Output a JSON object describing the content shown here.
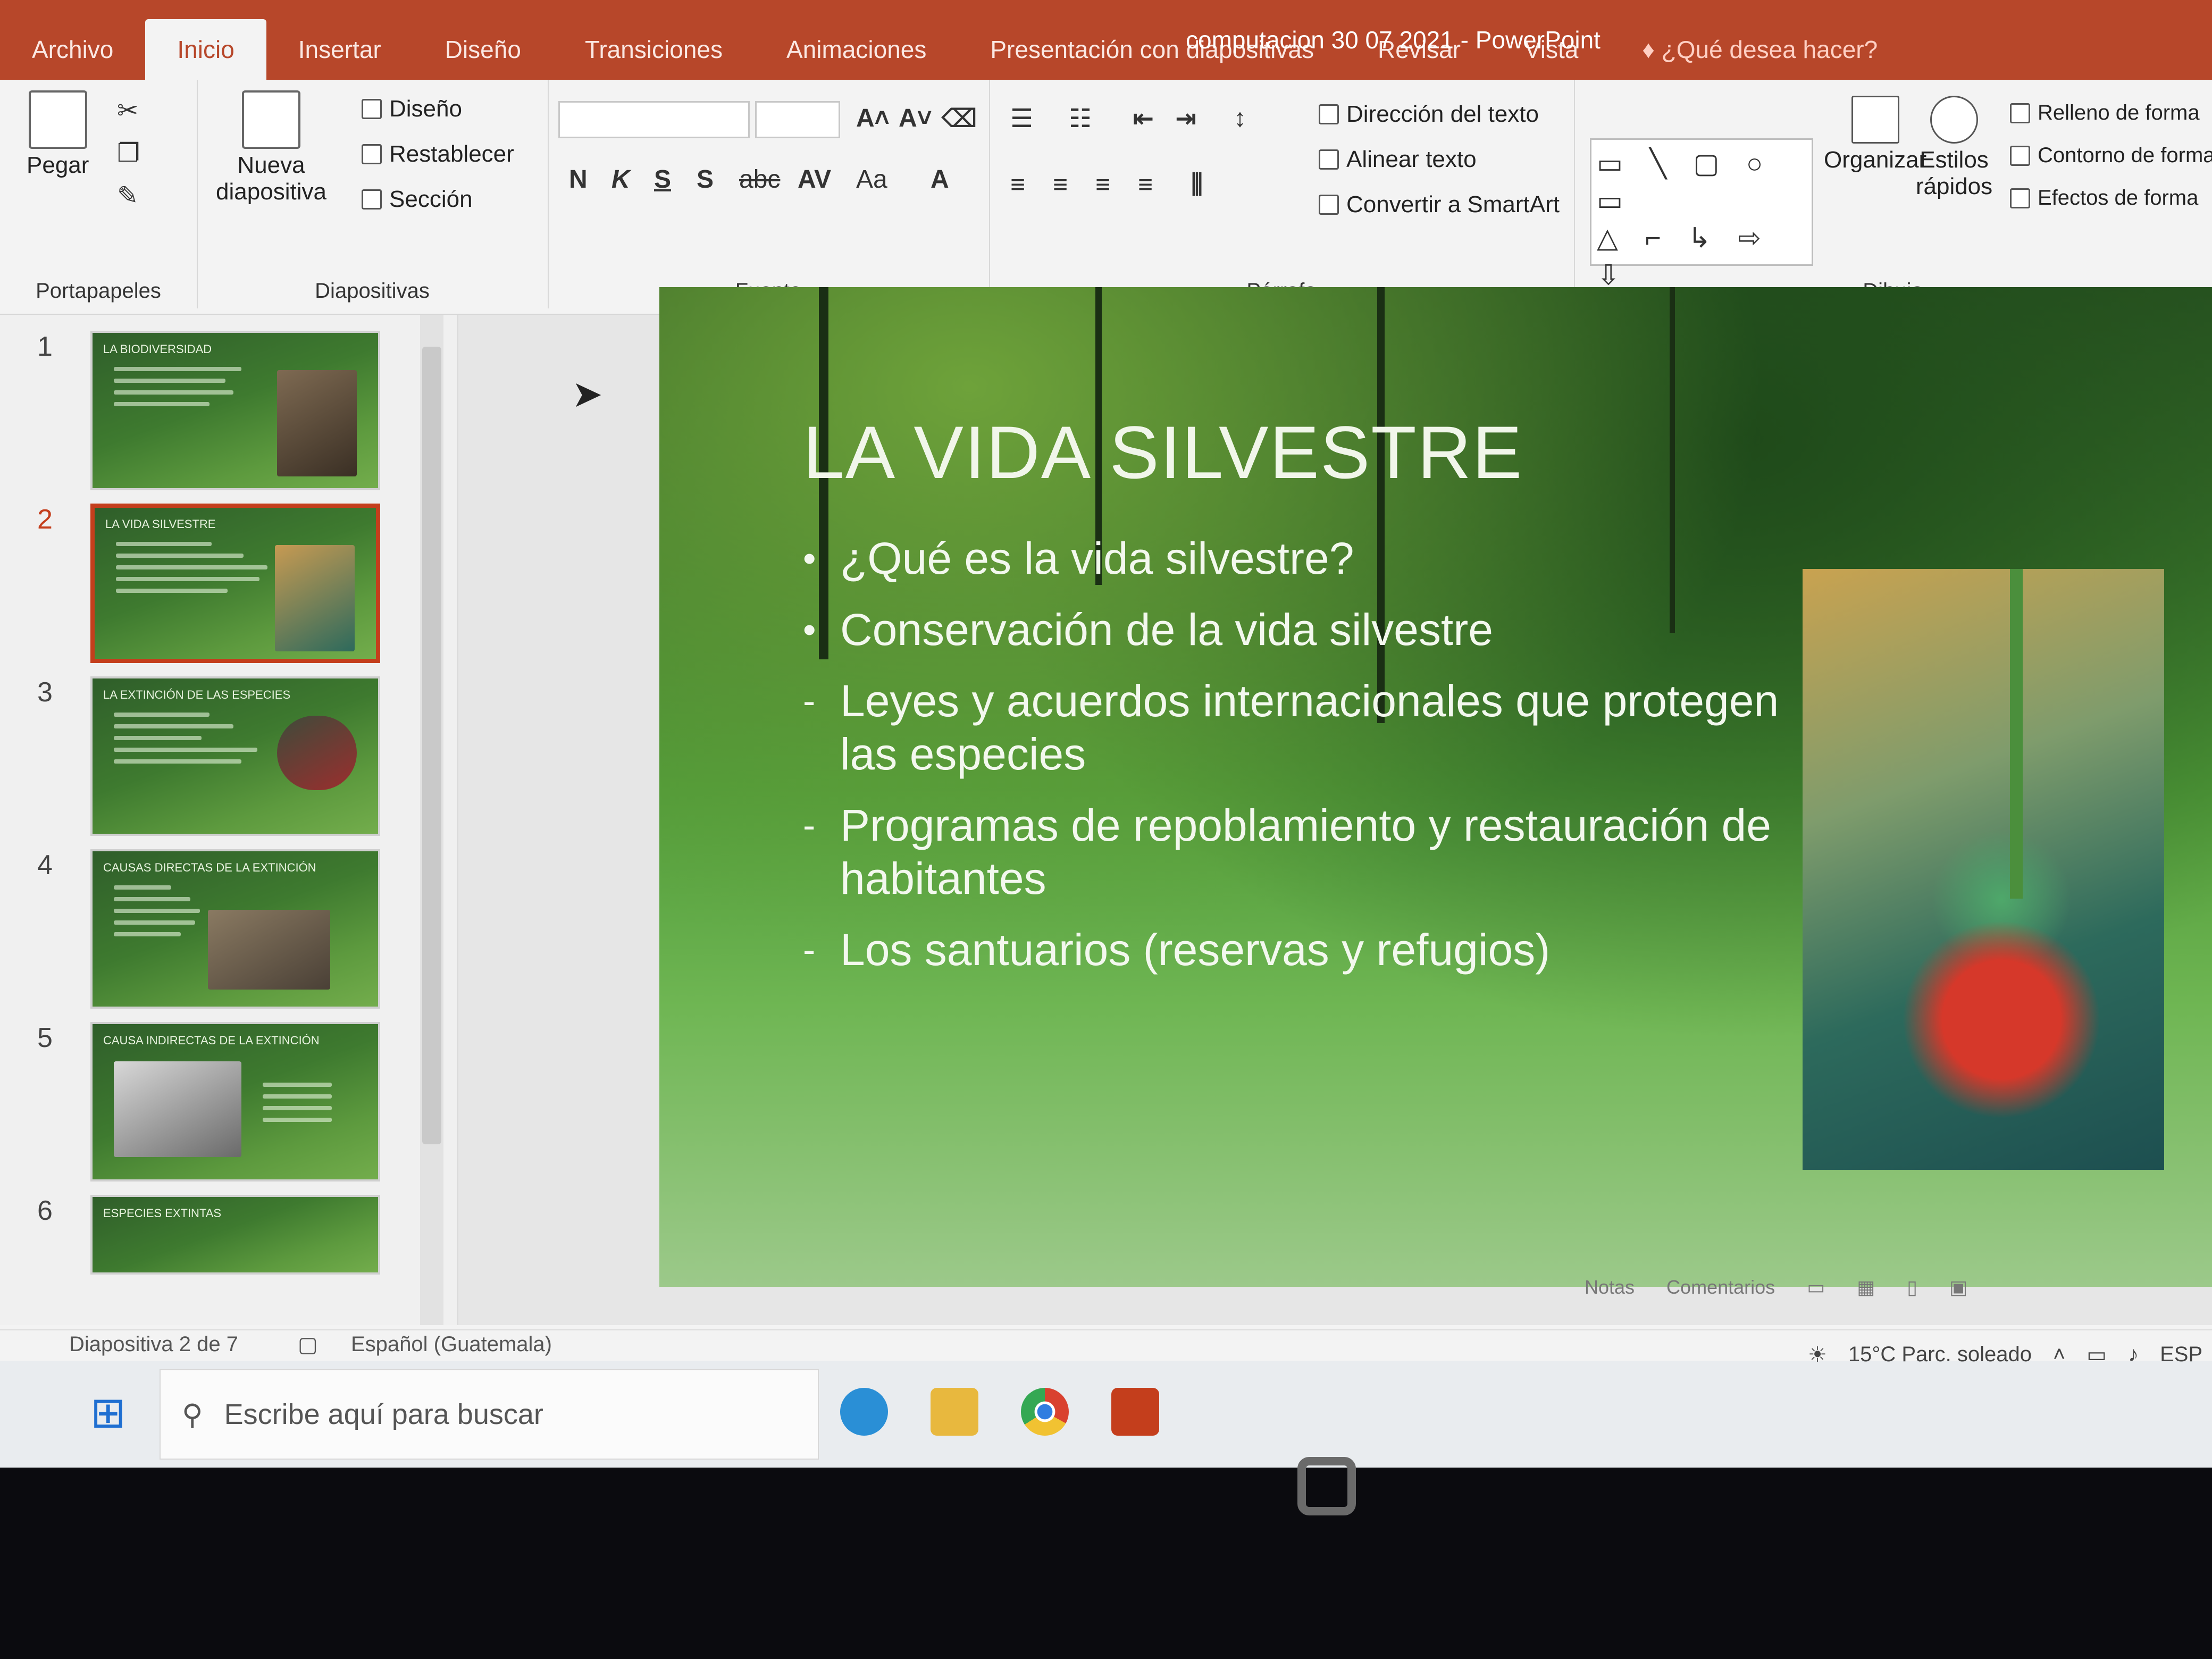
{
  "window": {
    "title": "computacion 30 07 2021 - PowerPoint"
  },
  "tabs": [
    "Archivo",
    "Inicio",
    "Insertar",
    "Diseño",
    "Transiciones",
    "Animaciones",
    "Presentación con diapositivas",
    "Revisar",
    "Vista"
  ],
  "tell_me": "¿Qué desea hacer?",
  "ribbon": {
    "portapapeles": {
      "label": "Portapapeles",
      "paste": "Pegar"
    },
    "diapositivas": {
      "label": "Diapositivas",
      "new_slide": "Nueva diapositiva",
      "layout": "Diseño",
      "reset": "Restablecer",
      "section": "Sección"
    },
    "fuente": {
      "label": "Fuente",
      "bold": "N",
      "italic": "K",
      "underline": "S",
      "shadow": "S",
      "strike": "abc",
      "spacing": "AV",
      "case": "Aa",
      "color": "A"
    },
    "parrafo": {
      "label": "Párrafo",
      "text_direction": "Dirección del texto",
      "align_text": "Alinear texto",
      "smartart": "Convertir a SmartArt"
    },
    "dibujo": {
      "label": "Dibujo",
      "arrange": "Organizar",
      "quick_styles": "Estilos rápidos",
      "fill": "Relleno de forma",
      "outline": "Contorno de forma",
      "effects": "Efectos de forma"
    }
  },
  "thumbnails": [
    {
      "num": "1",
      "title": "LA BIODIVERSIDAD"
    },
    {
      "num": "2",
      "title": "LA VIDA SILVESTRE"
    },
    {
      "num": "3",
      "title": "LA EXTINCIÓN DE LAS ESPECIES"
    },
    {
      "num": "4",
      "title": "CAUSAS DIRECTAS DE LA EXTINCIÓN"
    },
    {
      "num": "5",
      "title": "CAUSA INDIRECTAS DE LA EXTINCIÓN"
    },
    {
      "num": "6",
      "title": "ESPECIES EXTINTAS"
    }
  ],
  "slide": {
    "title": "LA VIDA SILVESTRE",
    "bullets": [
      {
        "text": "¿Qué es la vida silvestre?",
        "level": "bullet"
      },
      {
        "text": "Conservación de la vida silvestre",
        "level": "bullet"
      },
      {
        "text": "Leyes y acuerdos internacionales que protegen las especies",
        "level": "sub"
      },
      {
        "text": "Programas de repoblamiento y restauración de habitantes",
        "level": "sub"
      },
      {
        "text": "Los santuarios (reservas y refugios)",
        "level": "sub"
      }
    ]
  },
  "notes_bar": {
    "notes": "Notas",
    "comments": "Comentarios"
  },
  "status": {
    "slide_counter": "Diapositiva 2 de 7",
    "language": "Español (Guatemala)"
  },
  "taskbar": {
    "search_placeholder": "Escribe aquí para buscar",
    "weather": "15°C Parc. soleado",
    "lang": "ESP"
  },
  "colors": {
    "accent": "#b7472a",
    "selected_thumb": "#c43e1c"
  }
}
